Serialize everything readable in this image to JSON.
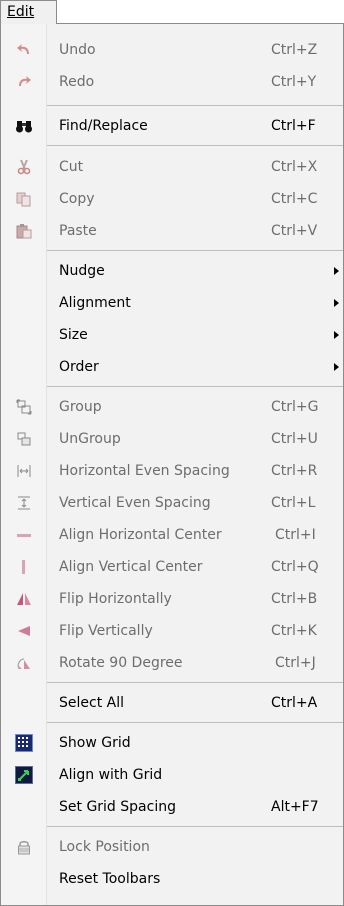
{
  "menubar": {
    "title": "Edit"
  },
  "items": [
    {
      "label": "Undo",
      "shortcut": "Ctrl+Z",
      "icon": "undo-icon",
      "disabled": true
    },
    {
      "label": "Redo",
      "shortcut": "Ctrl+Y",
      "icon": "redo-icon",
      "disabled": true
    },
    {
      "label": "Find/Replace",
      "shortcut": "Ctrl+F",
      "icon": "binoculars-icon",
      "disabled": false
    },
    {
      "label": "Cut",
      "shortcut": "Ctrl+X",
      "icon": "scissors-icon",
      "disabled": true
    },
    {
      "label": "Copy",
      "shortcut": "Ctrl+C",
      "icon": "copy-icon",
      "disabled": true
    },
    {
      "label": "Paste",
      "shortcut": "Ctrl+V",
      "icon": "paste-icon",
      "disabled": true
    },
    {
      "label": "Nudge",
      "submenu": true,
      "disabled": false
    },
    {
      "label": "Alignment",
      "submenu": true,
      "disabled": false
    },
    {
      "label": "Size",
      "submenu": true,
      "disabled": false
    },
    {
      "label": "Order",
      "submenu": true,
      "disabled": false
    },
    {
      "label": "Group",
      "shortcut": "Ctrl+G",
      "icon": "group-icon",
      "disabled": true
    },
    {
      "label": "UnGroup",
      "shortcut": "Ctrl+U",
      "icon": "ungroup-icon",
      "disabled": true
    },
    {
      "label": "Horizontal Even Spacing",
      "shortcut": "Ctrl+R",
      "icon": "horizontal-spacing-icon",
      "disabled": true
    },
    {
      "label": "Vertical Even Spacing",
      "shortcut": "Ctrl+L",
      "icon": "vertical-spacing-icon",
      "disabled": true
    },
    {
      "label": "Align Horizontal Center",
      "shortcut": "Ctrl+I",
      "icon": "align-horizontal-center-icon",
      "disabled": true
    },
    {
      "label": "Align Vertical Center",
      "shortcut": "Ctrl+Q",
      "icon": "align-vertical-center-icon",
      "disabled": true
    },
    {
      "label": "Flip Horizontally",
      "shortcut": "Ctrl+B",
      "icon": "flip-horizontal-icon",
      "disabled": true
    },
    {
      "label": "Flip Vertically",
      "shortcut": "Ctrl+K",
      "icon": "flip-vertical-icon",
      "disabled": true
    },
    {
      "label": "Rotate 90 Degree",
      "shortcut": "Ctrl+J",
      "icon": "rotate-icon",
      "disabled": true
    },
    {
      "label": "Select All",
      "shortcut": "Ctrl+A",
      "disabled": false
    },
    {
      "label": "Show Grid",
      "icon": "grid-checked-icon",
      "checked": true,
      "disabled": false
    },
    {
      "label": "Align with Grid",
      "icon": "align-grid-checked-icon",
      "checked": true,
      "disabled": false
    },
    {
      "label": "Set Grid Spacing",
      "shortcut": "Alt+F7",
      "disabled": false
    },
    {
      "label": "Lock Position",
      "icon": "lock-icon",
      "disabled": true
    },
    {
      "label": "Reset Toolbars",
      "disabled": false
    }
  ],
  "colors": {
    "menu_background": "#f2f2f2",
    "disabled_text": "#6d6d6d",
    "separator": "#bdbdbd",
    "icon_red": "#d84848",
    "icon_disabled": "#c7a3a3",
    "check_blue": "#1f3fa0"
  }
}
